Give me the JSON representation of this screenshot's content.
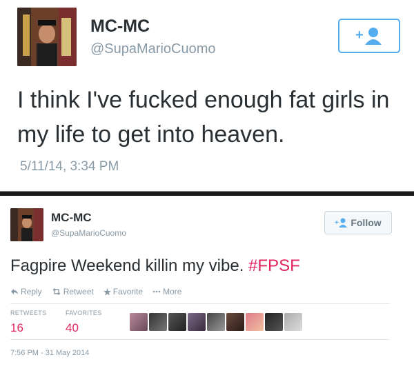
{
  "tweet1": {
    "name": "MC-MC",
    "handle": "@SupaMarioCuomo",
    "text": "I think I've fucked enough fat girls in my life to get into heaven.",
    "timestamp": "5/11/14, 3:34 PM",
    "follow_icon": "add-user-icon"
  },
  "tweet2": {
    "name": "MC-MC",
    "handle": "@SupaMarioCuomo",
    "follow_label": "Follow",
    "text": "Fagpire Weekend killin my vibe. ",
    "hashtag": "#FPSF",
    "actions": {
      "reply": "Reply",
      "retweet": "Retweet",
      "favorite": "Favorite",
      "more": "More"
    },
    "stats": {
      "retweets_label": "RETWEETS",
      "retweets": "16",
      "favorites_label": "FAVORITES",
      "favorites": "40"
    },
    "timestamp": "7:56 PM - 31 May 2014",
    "favoriter_avatars": 9
  },
  "colors": {
    "accent": "#55acee",
    "hashtag": "#e0245e",
    "muted": "#8899a6",
    "text": "#292f33"
  }
}
